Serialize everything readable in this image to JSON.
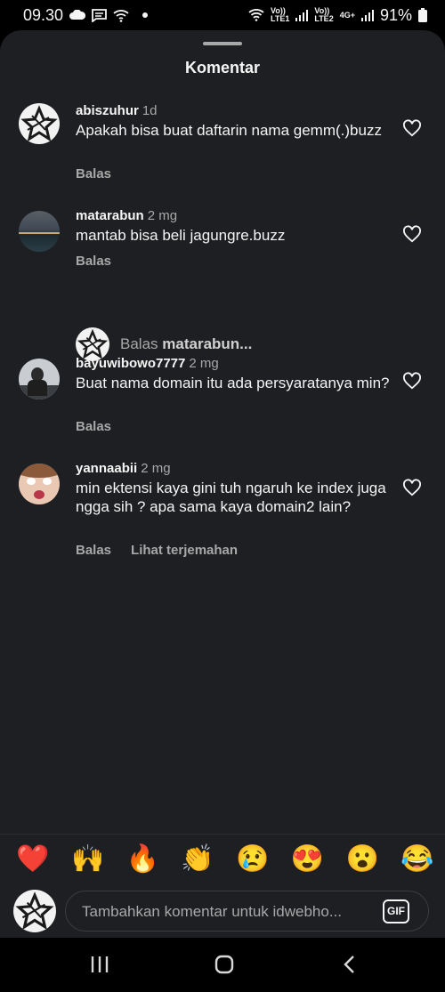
{
  "status_bar": {
    "time": "09.30",
    "net1_top": "Vo))",
    "net1_bottom": "LTE1",
    "net2_top": "Vo))",
    "net2_bottom": "LTE2",
    "net2_gen": "4G+",
    "battery": "91%"
  },
  "sheet": {
    "title": "Komentar"
  },
  "comments": [
    {
      "username": "abiszuhur",
      "time": "1d",
      "text": "Apakah bisa buat daftarin nama gemm(.)buzz",
      "reply_label": "Balas"
    },
    {
      "username": "matarabun",
      "time": "2 mg",
      "text": "mantab bisa beli jagungre.buzz",
      "reply_label": "Balas"
    },
    {
      "username": "bayuwibowo7777",
      "time": "2 mg",
      "text": "Buat nama domain itu ada persyaratanya min?",
      "reply_label": "Balas"
    },
    {
      "username": "yannaabii",
      "time": "2 mg",
      "text": "min ektensi kaya gini tuh ngaruh ke index juga ngga sih ? apa sama kaya domain2 lain?",
      "reply_label": "Balas",
      "translate_label": "Lihat terjemahan"
    }
  ],
  "reply_prompt": {
    "prefix": "Balas",
    "username": "matarabun..."
  },
  "emoji_bar": [
    "❤️",
    "🙌",
    "🔥",
    "👏",
    "😢",
    "😍",
    "😮",
    "😂"
  ],
  "input": {
    "placeholder": "Tambahkan komentar untuk idwebho...",
    "gif_label": "GIF"
  },
  "icons": {
    "like": "heart-outline-icon",
    "nav_recents": "recents-icon",
    "nav_home": "home-icon",
    "nav_back": "back-icon"
  }
}
